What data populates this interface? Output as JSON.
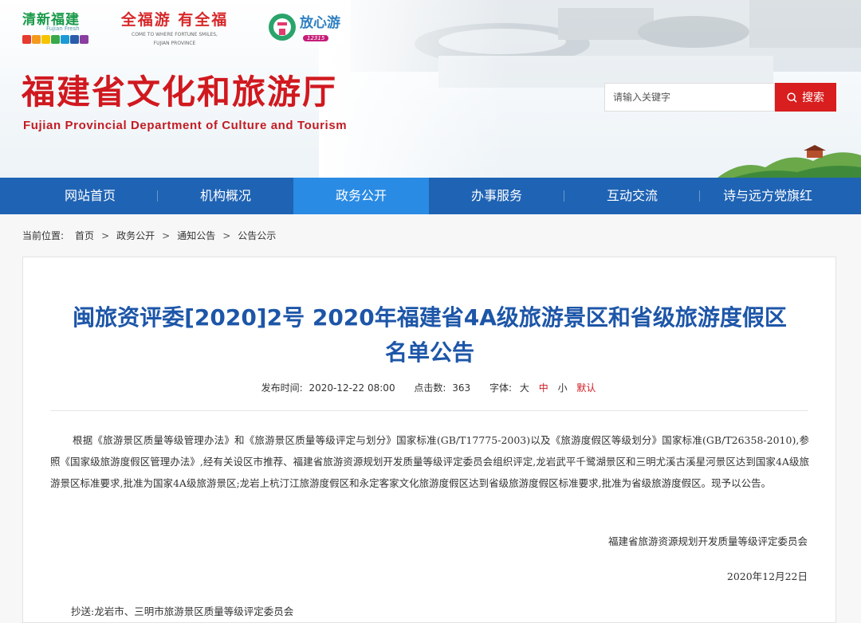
{
  "header": {
    "logos": {
      "logo1_text": "清新福建",
      "logo1_sub": "Fujian Fresh",
      "logo2_text": "全福游 有全福",
      "logo2_sub1": "COME TO WHERE FORTUNE SMILES,",
      "logo2_sub2": "FUJIAN PROVINCE",
      "logo3_text": "放心游",
      "logo3_pill": "12315"
    },
    "title": "福建省文化和旅游厅",
    "subtitle": "Fujian Provincial Department of Culture and Tourism",
    "search": {
      "placeholder": "请输入关键字",
      "button_label": "搜索"
    }
  },
  "nav": {
    "items": [
      {
        "label": "网站首页"
      },
      {
        "label": "机构概况"
      },
      {
        "label": "政务公开"
      },
      {
        "label": "办事服务"
      },
      {
        "label": "互动交流"
      },
      {
        "label": "诗与远方党旗红"
      }
    ],
    "active_index": 2
  },
  "breadcrumb": {
    "lead": "当前位置:",
    "items": [
      "首页",
      "政务公开",
      "通知公告",
      "公告公示"
    ],
    "separator": ">"
  },
  "article": {
    "title": "闽旅资评委[2020]2号 2020年福建省4A级旅游景区和省级旅游度假区名单公告",
    "meta": {
      "publish_label": "发布时间:",
      "publish_time": "2020-12-22 08:00",
      "clicks_label": "点击数:",
      "clicks": "363",
      "font_label": "字体:",
      "font_large": "大",
      "font_medium": "中",
      "font_small": "小",
      "font_default": "默认"
    },
    "body": "根据《旅游景区质量等级管理办法》和《旅游景区质量等级评定与划分》国家标准(GB/T17775-2003)以及《旅游度假区等级划分》国家标准(GB/T26358-2010),参照《国家级旅游度假区管理办法》,经有关设区市推荐、福建省旅游资源规划开发质量等级评定委员会组织评定,龙岩武平千鹭湖景区和三明尤溪古溪星河景区达到国家4A级旅游景区标准要求,批准为国家4A级旅游景区;龙岩上杭汀江旅游度假区和永定客家文化旅游度假区达到省级旅游度假区标准要求,批准为省级旅游度假区。现予以公告。",
    "signature": "福建省旅游资源规划开发质量等级评定委员会",
    "date": "2020年12月22日",
    "cc": "抄送:龙岩市、三明市旅游景区质量等级评定委员会"
  },
  "colors": {
    "brand_red": "#d0191f",
    "nav_blue": "#1f63b4",
    "nav_active": "#2a8be4",
    "title_blue": "#1d56a8",
    "search_button": "#d81e1e"
  }
}
